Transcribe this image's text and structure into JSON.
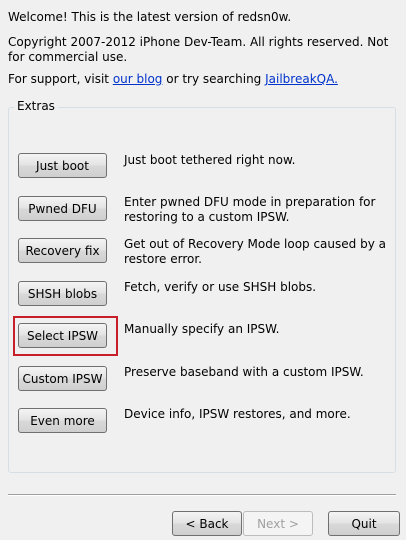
{
  "header": {
    "welcome": "Welcome!  This is the latest version of redsn0w.",
    "copyright_line1": "Copyright 2007-2012 iPhone Dev-Team. All rights reserved. Not",
    "copyright_line2": "for commercial use.",
    "support_prefix": "For support, visit ",
    "support_link1": "our blog",
    "support_middle": " or try searching ",
    "support_link2": "JailbreakQA."
  },
  "extras": {
    "title": "Extras",
    "items": [
      {
        "button": "Just boot",
        "desc": [
          "Just boot tethered right now."
        ]
      },
      {
        "button": "Pwned DFU",
        "desc": [
          "Enter pwned DFU mode in preparation for",
          "restoring to a custom IPSW."
        ]
      },
      {
        "button": "Recovery fix",
        "desc": [
          "Get out of Recovery Mode loop caused by a",
          "restore error."
        ]
      },
      {
        "button": "SHSH blobs",
        "desc": [
          "Fetch, verify or use SHSH blobs."
        ]
      },
      {
        "button": "Select IPSW",
        "desc": [
          "Manually specify an IPSW."
        ]
      },
      {
        "button": "Custom IPSW",
        "desc": [
          "Preserve baseband with a custom IPSW."
        ]
      },
      {
        "button": "Even more",
        "desc": [
          "Device info, IPSW restores, and more."
        ]
      }
    ]
  },
  "footer": {
    "back": "< Back",
    "next": "Next >",
    "quit": "Quit"
  },
  "colors": {
    "highlight": "#c8202a",
    "link": "#0033cc"
  }
}
